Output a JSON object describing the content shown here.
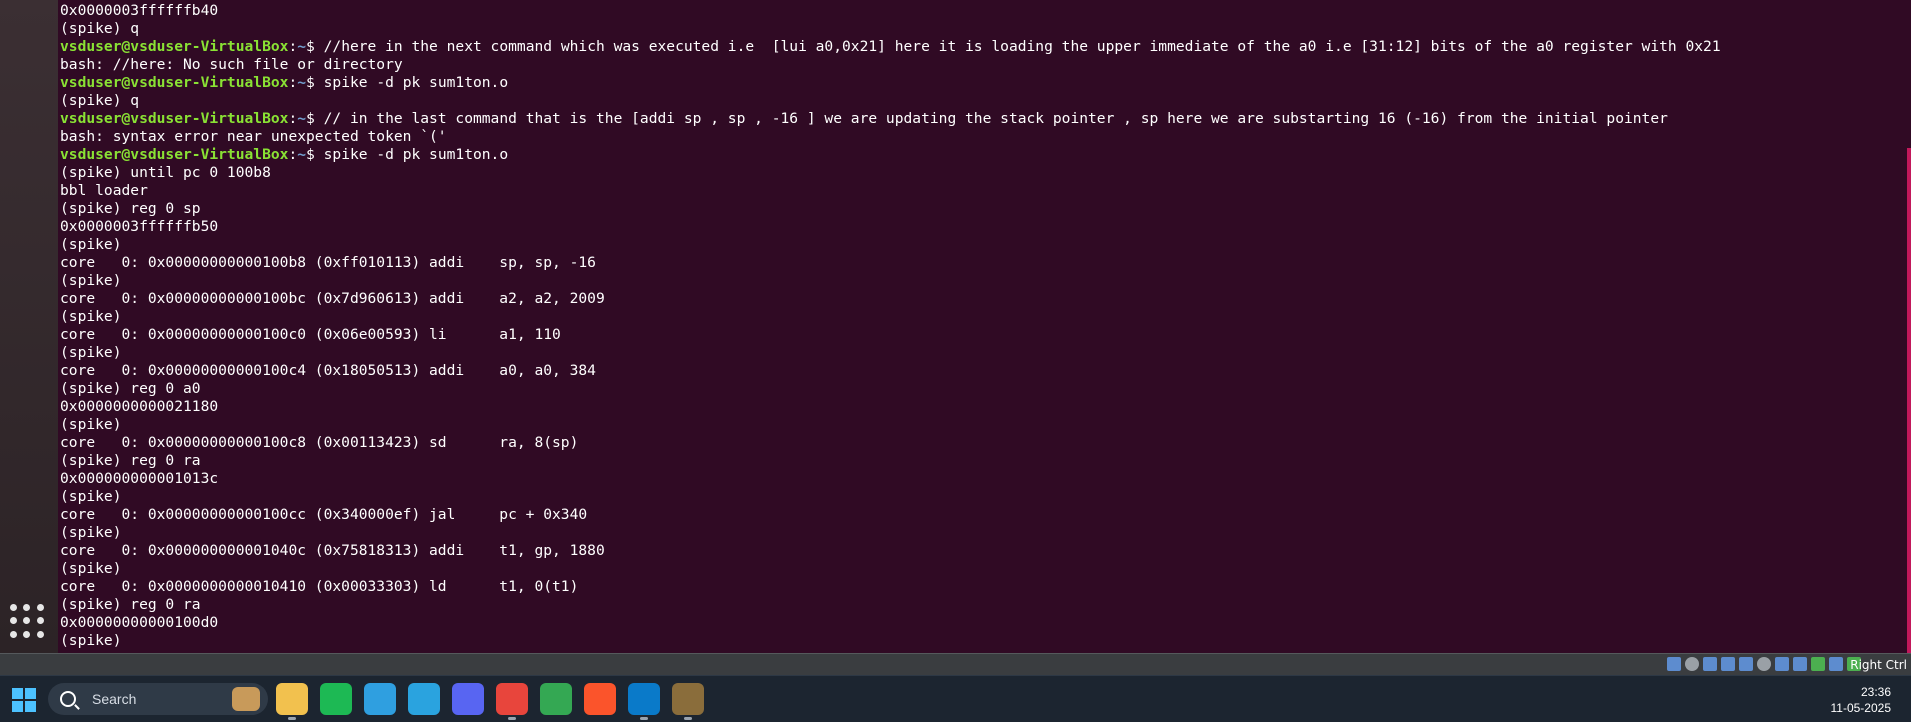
{
  "terminal": {
    "lines": [
      {
        "text": "0x0000003ffffffb40"
      },
      {
        "text": "(spike) q"
      },
      {
        "prompt_user": "vsduser@vsduser-VirtualBox",
        "prompt_path": "~",
        "cmd": "$ //here in the next command which was executed i.e  [lui a0,0x21] here it is loading the upper immediate of the a0 i.e [31:12] bits of the a0 register with 0x21"
      },
      {
        "text": "bash: //here: No such file or directory"
      },
      {
        "prompt_user": "vsduser@vsduser-VirtualBox",
        "prompt_path": "~",
        "cmd": "$ spike -d pk sum1ton.o"
      },
      {
        "text": "(spike) q"
      },
      {
        "prompt_user": "vsduser@vsduser-VirtualBox",
        "prompt_path": "~",
        "cmd": "$ // in the last command that is the [addi sp , sp , -16 ] we are updating the stack pointer , sp here we are substarting 16 (-16) from the initial pointer"
      },
      {
        "text": "bash: syntax error near unexpected token `('"
      },
      {
        "prompt_user": "vsduser@vsduser-VirtualBox",
        "prompt_path": "~",
        "cmd": "$ spike -d pk sum1ton.o"
      },
      {
        "text": "(spike) until pc 0 100b8"
      },
      {
        "text": "bbl loader"
      },
      {
        "text": "(spike) reg 0 sp"
      },
      {
        "text": "0x0000003ffffffb50"
      },
      {
        "text": "(spike)"
      },
      {
        "text": "core   0: 0x00000000000100b8 (0xff010113) addi    sp, sp, -16"
      },
      {
        "text": "(spike)"
      },
      {
        "text": "core   0: 0x00000000000100bc (0x7d960613) addi    a2, a2, 2009"
      },
      {
        "text": "(spike)"
      },
      {
        "text": "core   0: 0x00000000000100c0 (0x06e00593) li      a1, 110"
      },
      {
        "text": "(spike)"
      },
      {
        "text": "core   0: 0x00000000000100c4 (0x18050513) addi    a0, a0, 384"
      },
      {
        "text": "(spike) reg 0 a0"
      },
      {
        "text": "0x0000000000021180"
      },
      {
        "text": "(spike)"
      },
      {
        "text": "core   0: 0x00000000000100c8 (0x00113423) sd      ra, 8(sp)"
      },
      {
        "text": "(spike) reg 0 ra"
      },
      {
        "text": "0x000000000001013c"
      },
      {
        "text": "(spike)"
      },
      {
        "text": "core   0: 0x00000000000100cc (0x340000ef) jal     pc + 0x340"
      },
      {
        "text": "(spike)"
      },
      {
        "text": "core   0: 0x000000000001040c (0x75818313) addi    t1, gp, 1880"
      },
      {
        "text": "(spike)"
      },
      {
        "text": "core   0: 0x0000000000010410 (0x00033303) ld      t1, 0(t1)"
      },
      {
        "text": "(spike) reg 0 ra"
      },
      {
        "text": "0x00000000000100d0"
      },
      {
        "text": "(spike)"
      }
    ]
  },
  "vbox_status": {
    "host_key": "Right Ctrl"
  },
  "taskbar": {
    "search_placeholder": "Search",
    "time": "23:36",
    "date": "11-05-2025",
    "apps": [
      {
        "icon": "file-explorer-icon",
        "color": "#f2c14e",
        "running": true
      },
      {
        "icon": "spotify-icon",
        "color": "#1db954",
        "running": false
      },
      {
        "icon": "edge-icon",
        "color": "#2f9fe0",
        "running": false
      },
      {
        "icon": "telegram-icon",
        "color": "#2aa3df",
        "running": false
      },
      {
        "icon": "discord-icon",
        "color": "#5865f2",
        "running": false
      },
      {
        "icon": "chrome-icon",
        "color": "#e8453c",
        "running": true
      },
      {
        "icon": "chrome-profile-icon",
        "color": "#34a853",
        "running": false
      },
      {
        "icon": "brave-icon",
        "color": "#fb542b",
        "running": false
      },
      {
        "icon": "vscode-icon",
        "color": "#0a7ac9",
        "running": true
      },
      {
        "icon": "virtualbox-icon",
        "color": "#8a6d3b",
        "running": true
      }
    ]
  }
}
